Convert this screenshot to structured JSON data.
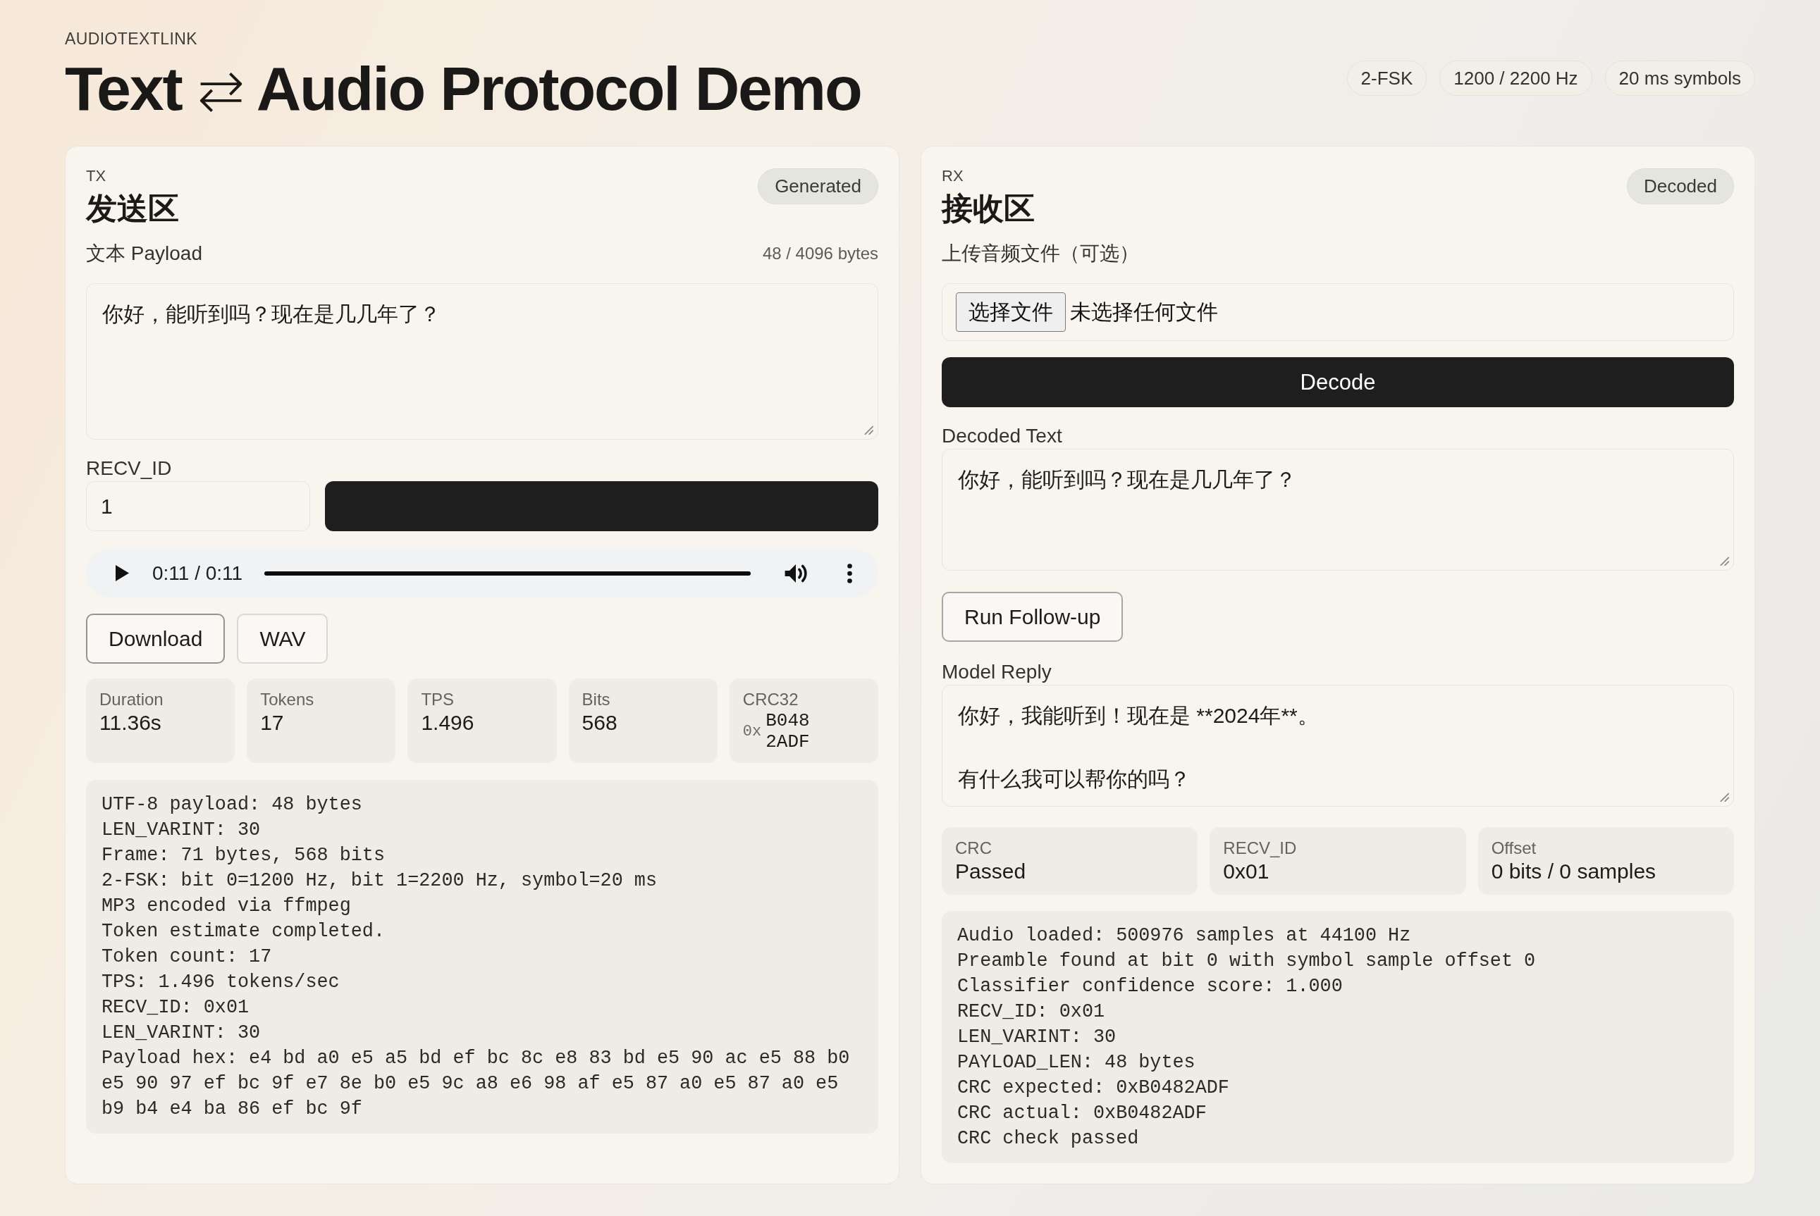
{
  "header": {
    "brand": "AUDIOTEXTLINK",
    "title_parts": [
      "Text",
      "⇄",
      "Audio Protocol Demo"
    ],
    "chips": [
      "2-FSK",
      "1200 / 2200 Hz",
      "20 ms symbols"
    ]
  },
  "tx": {
    "eyebrow": "TX",
    "title": "发送区",
    "status": "Generated",
    "payload_label": "文本 Payload",
    "byte_count": "48 / 4096 bytes",
    "payload": "你好，能听到吗？现在是几几年了？",
    "recv_id_label": "RECV_ID",
    "recv_id": "1",
    "audio_player": {
      "time": "0:11 / 0:11",
      "level": 1
    },
    "buttons": [
      {
        "label": "Download",
        "kind": "emphasis"
      },
      {
        "label": "WAV",
        "kind": "plain"
      }
    ],
    "stats": [
      {
        "kind": "text",
        "label": "Duration",
        "value": "11.36s"
      },
      {
        "kind": "text",
        "label": "Tokens",
        "value": "17"
      },
      {
        "kind": "text",
        "label": "TPS",
        "value": "1.496"
      },
      {
        "kind": "text",
        "label": "Bits",
        "value": "568"
      },
      {
        "kind": "hex",
        "label": "CRC32",
        "prefix": "0x",
        "value": "B0482ADF"
      }
    ],
    "log": [
      "UTF-8 payload: 48 bytes",
      "LEN_VARINT: 30",
      "Frame: 71 bytes, 568 bits",
      "2-FSK: bit 0=1200 Hz, bit 1=2200 Hz, symbol=20 ms",
      "MP3 encoded via ffmpeg",
      "Token estimate completed.",
      "Token count: 17",
      "TPS: 1.496 tokens/sec",
      "RECV_ID: 0x01",
      "LEN_VARINT: 30",
      "Payload hex: e4 bd a0 e5 a5 bd ef bc 8c e8 83 bd e5 90 ac e5 88 b0 e5 90 97 ef bc 9f e7 8e b0 e5 9c a8 e6 98 af e5 87 a0 e5 87 a0 e5 b9 b4 e4 ba 86 ef bc 9f"
    ]
  },
  "rx": {
    "eyebrow": "RX",
    "title": "接收区",
    "status": "Decoded",
    "upload_label": "上传音频文件（可选）",
    "file_button": "选择文件",
    "file_status": "未选择任何文件",
    "decode_button": "Decode",
    "decoded_label": "Decoded Text",
    "decoded_text": "你好，能听到吗？现在是几几年了？",
    "followup_button": "Run Follow-up",
    "reply_label": "Model Reply",
    "reply_paragraphs": [
      "你好，我能听到！现在是 **2024年**。",
      "有什么我可以帮你的吗？"
    ],
    "stats": [
      {
        "kind": "text",
        "label": "CRC",
        "value": "Passed"
      },
      {
        "kind": "text",
        "label": "RECV_ID",
        "value": "0x01"
      },
      {
        "kind": "text",
        "label": "Offset",
        "value": "0 bits / 0 samples"
      }
    ],
    "log": [
      "Audio loaded: 500976 samples at 44100 Hz",
      "Preamble found at bit 0 with symbol sample offset 0",
      "Classifier confidence score: 1.000",
      "RECV_ID: 0x01",
      "LEN_VARINT: 30",
      "PAYLOAD_LEN: 48 bytes",
      "CRC expected: 0xB0482ADF",
      "CRC actual: 0xB0482ADF",
      "CRC check passed"
    ]
  }
}
